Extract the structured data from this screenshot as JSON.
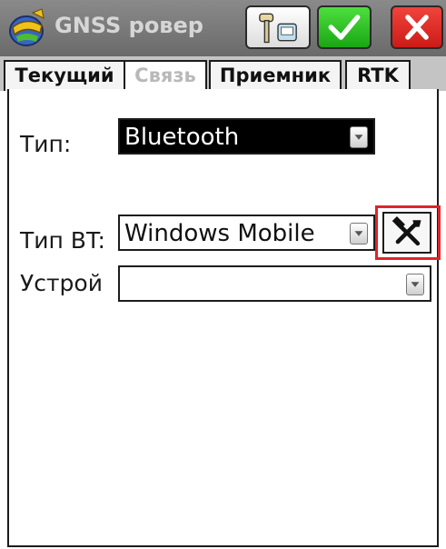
{
  "window": {
    "title": "GNSS ровер",
    "logo_icon": "app-logo-icon",
    "device_icon": "gnss-device-icon",
    "ok_icon": "checkmark-icon",
    "cancel_icon": "close-icon"
  },
  "tabs": [
    {
      "label": "Текущий",
      "active": false
    },
    {
      "label": "Связь",
      "active": true
    },
    {
      "label": "Приемник",
      "active": false
    },
    {
      "label": "RTK",
      "active": false
    }
  ],
  "form": {
    "type_label": "Тип:",
    "type_value": "Bluetooth",
    "bt_type_label": "Тип BT:",
    "bt_type_value": "Windows Mobile",
    "device_label": "Устрой",
    "device_value": "",
    "tool_icon": "hammer-wrench-icon"
  },
  "colors": {
    "titlebar": "#7a7a7a",
    "ok": "#2fc424",
    "cancel": "#e0282a",
    "highlight": "#e0242a",
    "selected_combo": "#000000"
  }
}
